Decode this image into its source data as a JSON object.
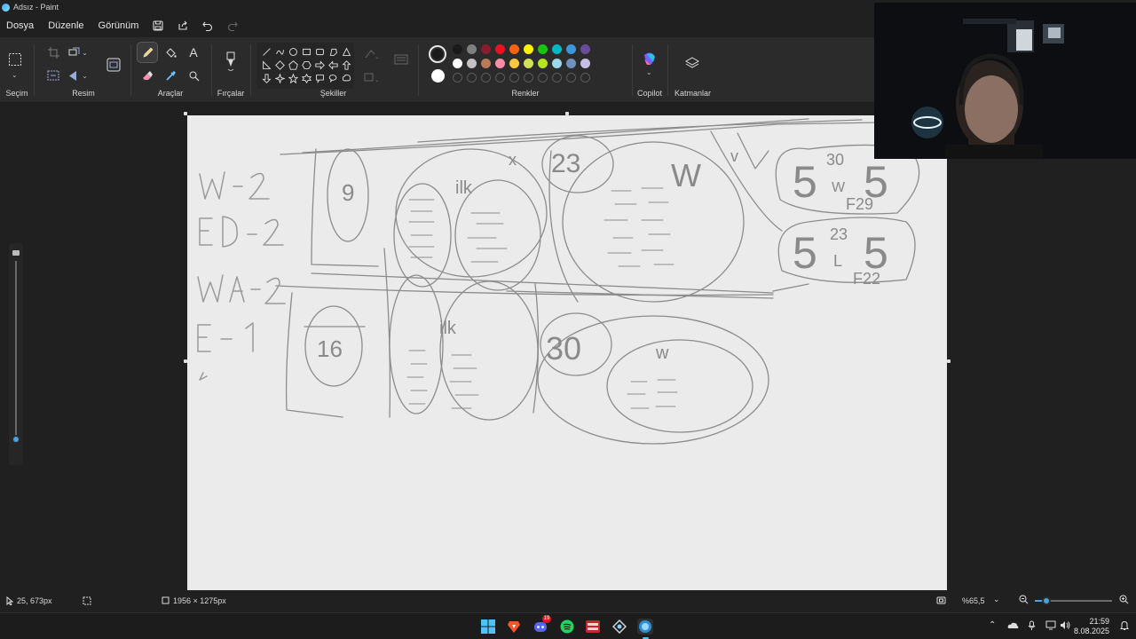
{
  "window": {
    "title": "Adsız - Paint"
  },
  "menu": {
    "file": "Dosya",
    "edit": "Düzenle",
    "view": "Görünüm"
  },
  "ribbon": {
    "groups": {
      "selection": "Seçim",
      "image": "Resim",
      "tools": "Araçlar",
      "brushes": "Fırçalar",
      "shapes": "Şekiller",
      "colors": "Renkler",
      "copilot": "Copilot",
      "layers": "Katmanlar"
    },
    "palette_row1": [
      "#1a1a1a",
      "#7f7f7f",
      "#8a1c2b",
      "#e81224",
      "#f7630c",
      "#fff100",
      "#16c60c",
      "#00b7c3",
      "#3a96dd",
      "#6b4c9a"
    ],
    "palette_row2": [
      "#ffffff",
      "#c3c3c3",
      "#b97a57",
      "#ff8ba7",
      "#ffc83d",
      "#d4e157",
      "#b5e61d",
      "#99d9ea",
      "#7092be",
      "#c8bfe7"
    ],
    "primary_color": "#1a1a1a",
    "secondary_color": "#ffffff",
    "active_tool": "pencil"
  },
  "drawing": {
    "labels": [
      "W-2",
      "ED-2",
      "WA-2",
      "E-1"
    ],
    "bubbles": [
      "9",
      "16",
      "30"
    ],
    "words": [
      "ilk",
      "ilk",
      "W",
      "w",
      "W",
      "x",
      "v"
    ],
    "left_stack": {
      "top": "30",
      "mid": "W",
      "bottom": "F29",
      "big": "5",
      "big2": "5"
    },
    "right_stack": {
      "top": "23",
      "mid": "L",
      "bottom": "F22",
      "big": "5",
      "big2": "5"
    },
    "circle_top": "23"
  },
  "status": {
    "cursor_pos": "25, 673px",
    "canvas_size": "1956 × 1275px",
    "zoom": "%65,5"
  },
  "taskbar": {
    "time": "21:59",
    "date": "8.08.2025",
    "discord_badge": "19"
  }
}
